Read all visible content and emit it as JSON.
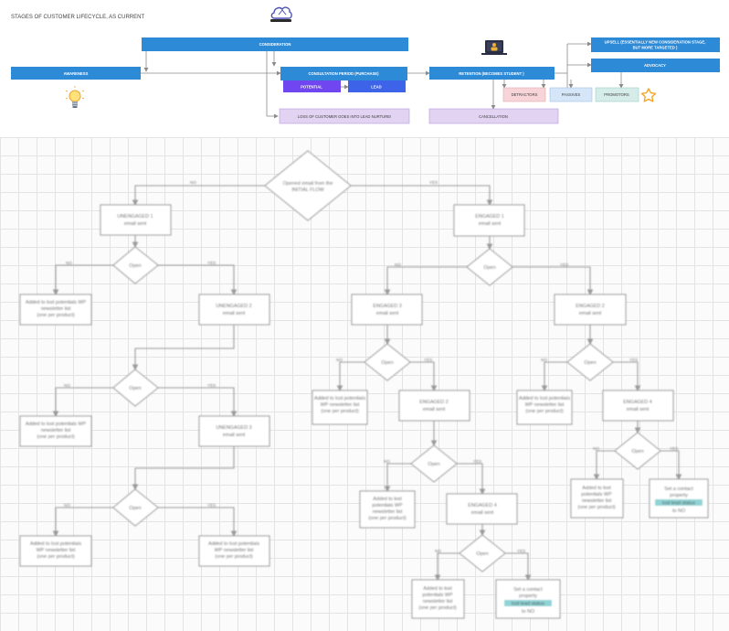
{
  "lifecycle": {
    "title": "STAGES OF CUSTOMER LIFECYCLE, AS CURRENT",
    "stages": {
      "awareness": "AWARENESS",
      "consideration": "CONSIDERATION",
      "consultation": "CONSULTATION PERIOD (PURCHASE)",
      "potential": "POTENTIAL",
      "lead": "LEAD",
      "loss": "LOSS OF CUSTOMER GOES INTO LEAD NURTURE!",
      "retention": "RETENTION (BECOMES STUDENT )",
      "upsell_line1": "UPSELL (ESSENTIALLY NEW CONSIDERATION STAGE,",
      "upsell_line2": "BUT MORE TARGETED )",
      "advocacy": "ADVOCACY",
      "detractors": "DETRACTORS",
      "passives": "PASSIVES",
      "promotors": "PROMOTORS",
      "cancellation": "CANCELLATION"
    },
    "icons": {
      "cloud": "cloud-head-icon",
      "bulb": "lightbulb-icon",
      "laptop": "laptop-user-icon",
      "star": "star-icon"
    },
    "colors": {
      "stage_blue": "#2d8ad7",
      "potential_purple": "#7046f0",
      "lead_blue": "#3d64e8",
      "lavender": "#e3d3f3",
      "pink": "#f7d4d8",
      "light_blue": "#d4e6f7",
      "mint": "#d6ece9",
      "star_orange": "#f5a623"
    }
  },
  "flowchart": {
    "start": [
      "Opened email from the",
      "INITIAL FLOW"
    ],
    "branch_no": "NO",
    "branch_yes": "YES",
    "decision": "Open",
    "unengaged_1": [
      "UNENGAGED 1",
      "email sent"
    ],
    "unengaged_2": [
      "UNENGAGED 2",
      "email sent"
    ],
    "unengaged_3": [
      "UNENGAGED 3",
      "email sent"
    ],
    "engaged_1": [
      "ENGAGED 1",
      "email sent"
    ],
    "engaged_2": [
      "ENGAGED 2",
      "email sent"
    ],
    "engaged_3": [
      "ENGAGED 3",
      "email sent"
    ],
    "engaged_4": [
      "ENGAGED 4",
      "email sent"
    ],
    "added_a": [
      "Added to lost potentials WP",
      "newsletter list",
      "(one per product)"
    ],
    "added_b": [
      "Added to lost potentials",
      "WP newsletter list",
      "(one per product)"
    ],
    "added_c": [
      "Added to lost",
      "potentials WP",
      "newsletter list",
      "(one per product)"
    ],
    "set_contact": [
      "Set a contact",
      "property",
      "lost lead status",
      "to NO"
    ]
  }
}
